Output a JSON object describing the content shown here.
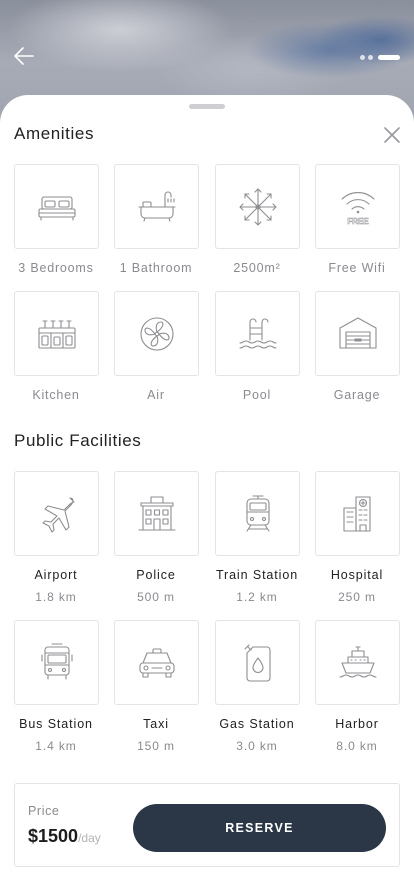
{
  "header": {
    "back_icon": "arrow-left-icon",
    "pager": {
      "count": 3,
      "active": 3
    }
  },
  "amenities": {
    "title": "Amenities",
    "close_icon": "close-icon",
    "items": [
      {
        "label": "3 Bedrooms",
        "icon": "bed-icon"
      },
      {
        "label": "1 Bathroom",
        "icon": "bathtub-icon"
      },
      {
        "label": "2500m²",
        "icon": "area-expand-icon"
      },
      {
        "label": "Free Wifi",
        "icon": "wifi-icon",
        "icon_text": "FREE"
      },
      {
        "label": "Kitchen",
        "icon": "kitchen-icon"
      },
      {
        "label": "Air",
        "icon": "air-conditioner-icon"
      },
      {
        "label": "Pool",
        "icon": "pool-icon"
      },
      {
        "label": "Garage",
        "icon": "garage-icon"
      }
    ]
  },
  "facilities": {
    "title": "Public Facilities",
    "items": [
      {
        "name": "Airport",
        "distance": "1.8 km",
        "icon": "airplane-icon"
      },
      {
        "name": "Police",
        "distance": "500 m",
        "icon": "police-station-icon"
      },
      {
        "name": "Train Station",
        "distance": "1.2 km",
        "icon": "train-icon"
      },
      {
        "name": "Hospital",
        "distance": "250 m",
        "icon": "hospital-icon"
      },
      {
        "name": "Bus Station",
        "distance": "1.4 km",
        "icon": "bus-icon"
      },
      {
        "name": "Taxi",
        "distance": "150 m",
        "icon": "taxi-icon"
      },
      {
        "name": "Gas Station",
        "distance": "3.0 km",
        "icon": "gas-can-icon"
      },
      {
        "name": "Harbor",
        "distance": "8.0 km",
        "icon": "ship-icon"
      }
    ]
  },
  "footer": {
    "price_label": "Price",
    "price_value": "$1500",
    "price_unit": "/day",
    "reserve_label": "RESERVE"
  },
  "colors": {
    "accent": "#2b3747",
    "icon_stroke": "#8e8e93",
    "muted_text": "#8a8a90",
    "border": "#e4e4e8"
  }
}
